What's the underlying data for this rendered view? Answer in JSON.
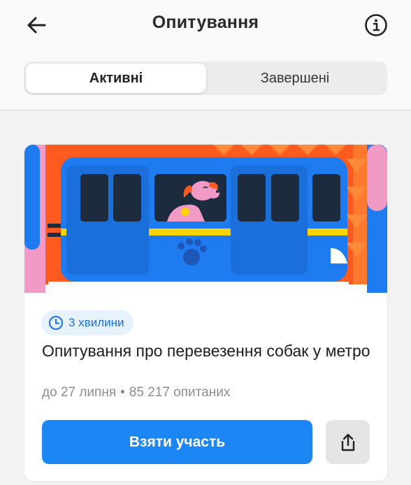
{
  "header": {
    "title": "Опитування",
    "back_icon": "arrow-left-icon",
    "info_icon": "info-icon"
  },
  "tabs": [
    {
      "label": "Активні",
      "selected": true
    },
    {
      "label": "Завершені",
      "selected": false
    }
  ],
  "survey": {
    "duration": "3 хвилини",
    "title": "Опитування про перевезення собак у метро",
    "deadline": "до 27 липня",
    "separator": "•",
    "respondents": "85 217 опитаних",
    "participate_label": "Взяти участь",
    "share_icon": "share-icon",
    "illustration": "dog-on-metro-illustration"
  },
  "colors": {
    "accent": "#1b86f4",
    "badge_bg": "#e7f2ff",
    "badge_text": "#1c6fe0",
    "train_blue": "#1e7cf0",
    "orange": "#ff5a1f",
    "pink": "#f29ac6"
  }
}
